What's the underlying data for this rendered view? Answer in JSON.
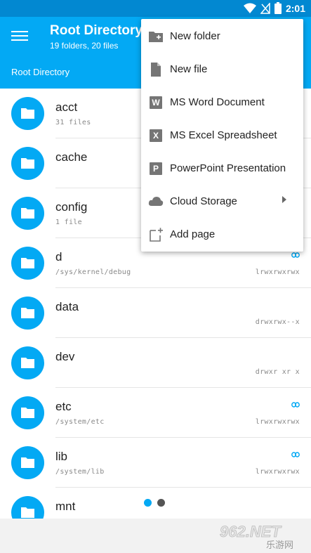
{
  "status_bar": {
    "time": "2:01",
    "icons": [
      "wifi-icon",
      "signal-off-icon",
      "battery-icon"
    ]
  },
  "app_bar": {
    "title": "Root Directory",
    "subtitle": "19 folders, 20 files",
    "breadcrumb": "Root Directory"
  },
  "colors": {
    "primary": "#03a9f4",
    "primary_dark": "#0288d1",
    "menu_icon": "#757575"
  },
  "files": [
    {
      "name": "acct",
      "sub": "31 files",
      "perm": "",
      "link": false
    },
    {
      "name": "cache",
      "sub": "",
      "perm": "",
      "link": false
    },
    {
      "name": "config",
      "sub": "1 file",
      "perm": "",
      "link": false
    },
    {
      "name": "d",
      "sub": "/sys/kernel/debug",
      "perm": "lrwxrwxrwx",
      "link": true
    },
    {
      "name": "data",
      "sub": "",
      "perm": "drwxrwx--x",
      "link": false
    },
    {
      "name": "dev",
      "sub": "",
      "perm": "drwxr xr x",
      "link": false
    },
    {
      "name": "etc",
      "sub": "/system/etc",
      "perm": "lrwxrwxrwx",
      "link": true
    },
    {
      "name": "lib",
      "sub": "/system/lib",
      "perm": "lrwxrwxrwx",
      "link": true
    },
    {
      "name": "mnt",
      "sub": "",
      "perm": "",
      "link": false
    }
  ],
  "menu": {
    "items": [
      {
        "label": "New folder",
        "icon": "new-folder-icon"
      },
      {
        "label": "New file",
        "icon": "file-icon"
      },
      {
        "label": "MS Word Document",
        "icon": "word-icon",
        "letter": "W"
      },
      {
        "label": "MS Excel Spreadsheet",
        "icon": "excel-icon",
        "letter": "X"
      },
      {
        "label": "PowerPoint Presentation",
        "icon": "powerpoint-icon",
        "letter": "P"
      },
      {
        "label": "Cloud Storage",
        "icon": "cloud-icon"
      },
      {
        "label": "Add page",
        "icon": "add-page-icon"
      }
    ]
  },
  "pager": {
    "current": 1,
    "total": 2
  },
  "watermark": {
    "text": "962.NET",
    "subtext": "乐游网"
  }
}
